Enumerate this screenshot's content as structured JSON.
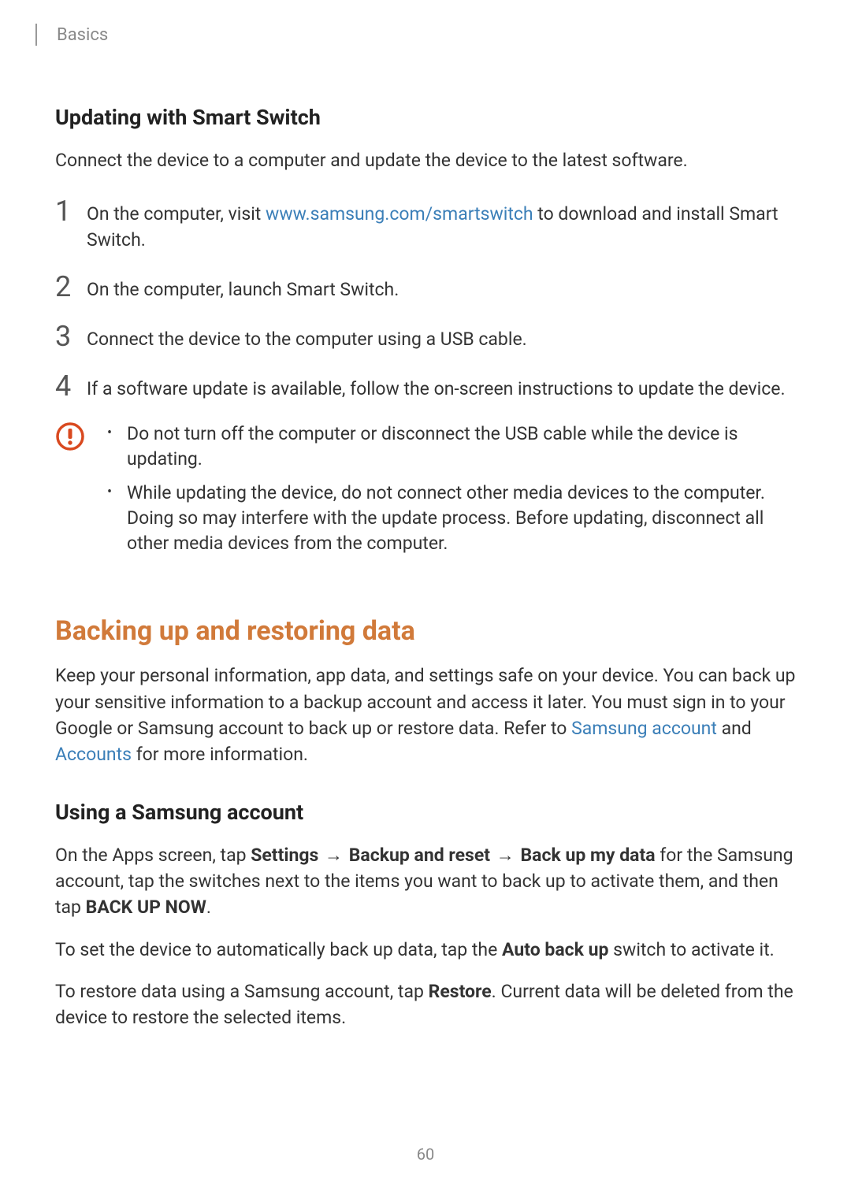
{
  "header": {
    "breadcrumb": "Basics"
  },
  "section1": {
    "heading": "Updating with Smart Switch",
    "intro": "Connect the device to a computer and update the device to the latest software.",
    "steps": {
      "nums": [
        "1",
        "2",
        "3",
        "4"
      ],
      "step1_pre": "On the computer, visit ",
      "step1_link": "www.samsung.com/smartswitch",
      "step1_post": " to download and install Smart Switch.",
      "step2": "On the computer, launch Smart Switch.",
      "step3": "Connect the device to the computer using a USB cable.",
      "step4": "If a software update is available, follow the on-screen instructions to update the device."
    },
    "caution": {
      "b1": "Do not turn off the computer or disconnect the USB cable while the device is updating.",
      "b2": "While updating the device, do not connect other media devices to the computer. Doing so may interfere with the update process. Before updating, disconnect all other media devices from the computer."
    }
  },
  "section2": {
    "heading": "Backing up and restoring data",
    "intro_pre": "Keep your personal information, app data, and settings safe on your device. You can back up your sensitive information to a backup account and access it later. You must sign in to your Google or Samsung account to back up or restore data. Refer to ",
    "intro_link1": "Samsung account",
    "intro_mid": " and ",
    "intro_link2": "Accounts",
    "intro_post": " for more information.",
    "sub_heading": "Using a Samsung account",
    "p1_pre": "On the Apps screen, tap ",
    "p1_settings": "Settings",
    "p1_arrow": "→",
    "p1_backup": "Backup and reset",
    "p1_backupmy": "Back up my data",
    "p1_mid": " for the Samsung account, tap the switches next to the items you want to back up to activate them, and then tap ",
    "p1_backupnow": "BACK UP NOW",
    "p1_end": ".",
    "p2_pre": "To set the device to automatically back up data, tap the ",
    "p2_auto": "Auto back up",
    "p2_post": " switch to activate it.",
    "p3_pre": "To restore data using a Samsung account, tap ",
    "p3_restore": "Restore",
    "p3_post": ". Current data will be deleted from the device to restore the selected items."
  },
  "page_number": "60"
}
